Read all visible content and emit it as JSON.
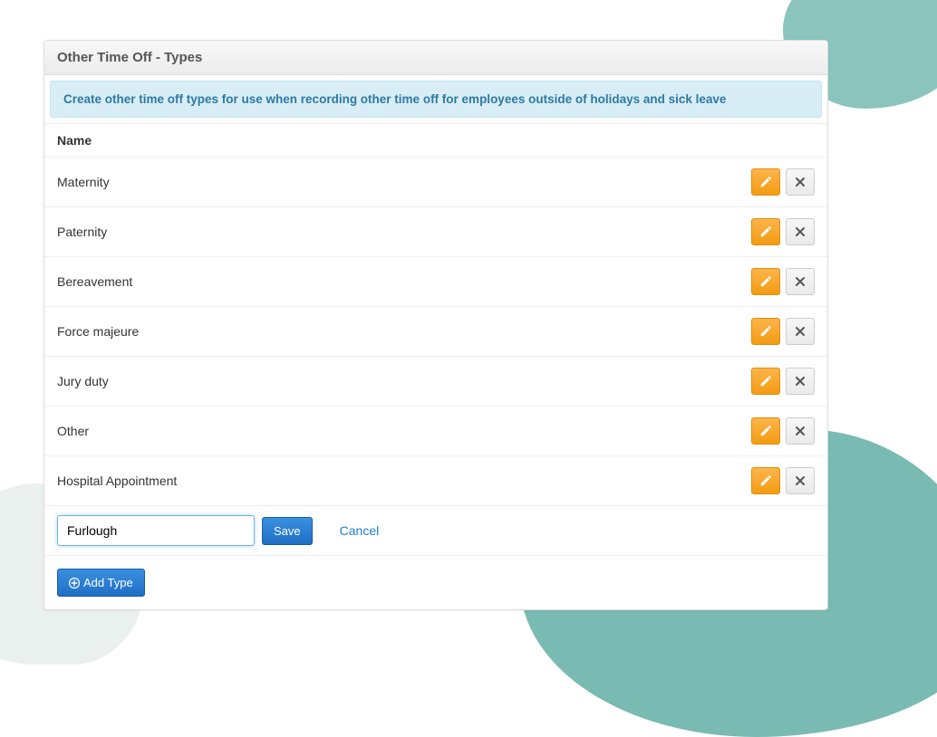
{
  "panel": {
    "title": "Other Time Off - Types",
    "info": "Create other time off types for use when recording other time off for employees outside of holidays and sick leave",
    "column_header": "Name",
    "rows": [
      {
        "name": "Maternity"
      },
      {
        "name": "Paternity"
      },
      {
        "name": "Bereavement"
      },
      {
        "name": "Force majeure"
      },
      {
        "name": "Jury duty"
      },
      {
        "name": "Other"
      },
      {
        "name": "Hospital Appointment"
      }
    ],
    "form": {
      "input_value": "Furlough",
      "save_label": "Save",
      "cancel_label": "Cancel"
    },
    "add_button_label": "Add Type"
  }
}
